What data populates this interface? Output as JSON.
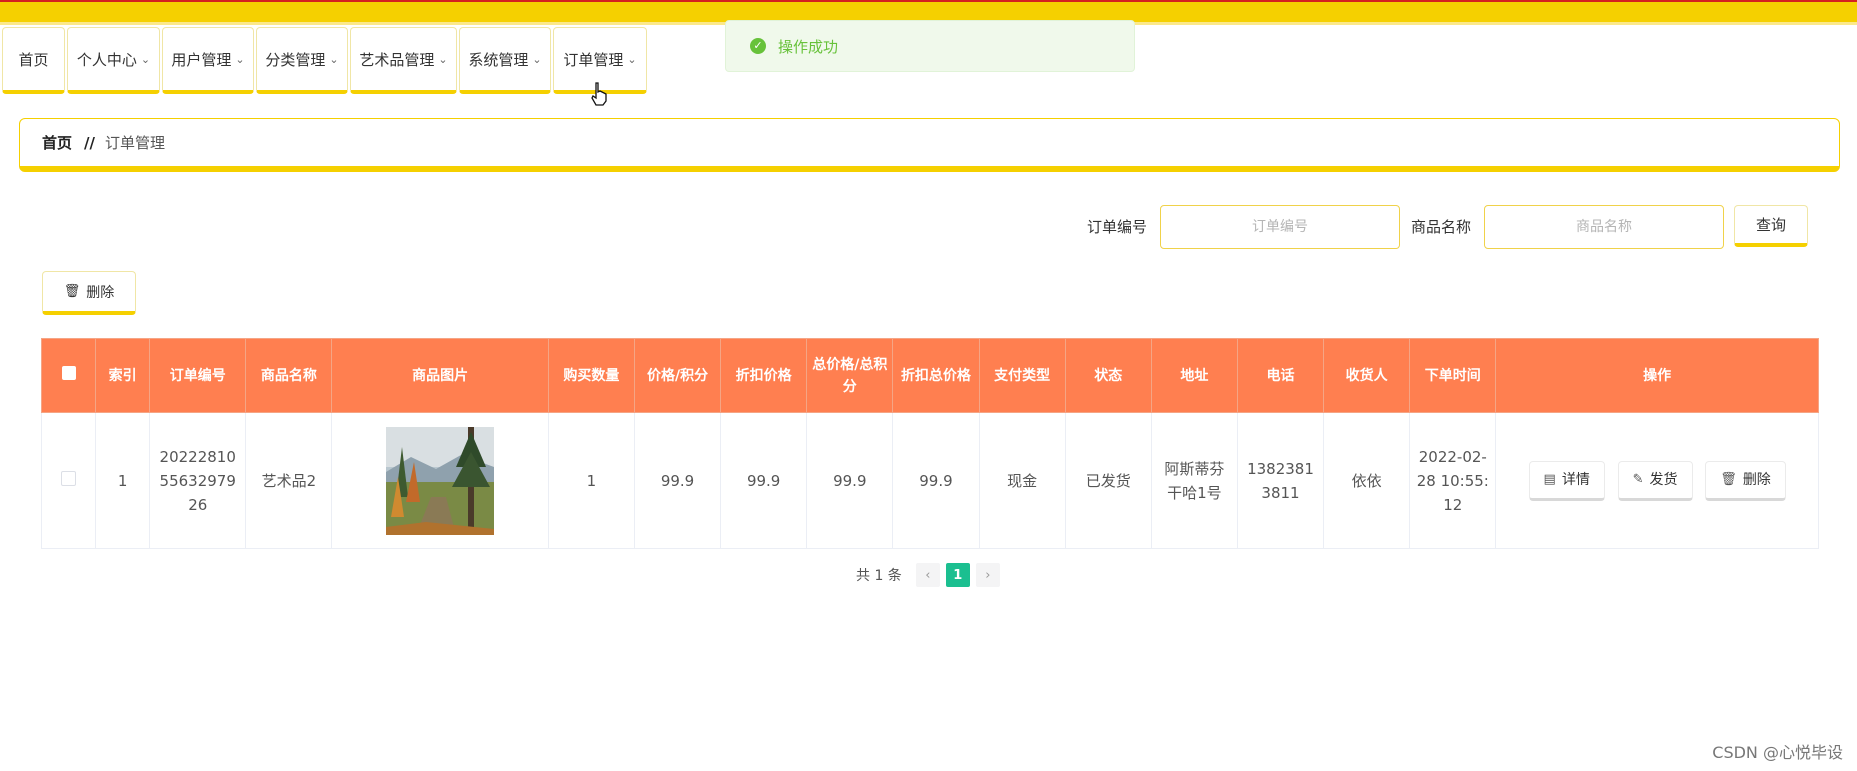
{
  "nav": {
    "items": [
      {
        "label": "首页",
        "has_dropdown": false
      },
      {
        "label": "个人中心",
        "has_dropdown": true
      },
      {
        "label": "用户管理",
        "has_dropdown": true
      },
      {
        "label": "分类管理",
        "has_dropdown": true
      },
      {
        "label": "艺术品管理",
        "has_dropdown": true
      },
      {
        "label": "系统管理",
        "has_dropdown": true
      },
      {
        "label": "订单管理",
        "has_dropdown": true
      }
    ]
  },
  "toast": {
    "message": "操作成功",
    "icon": "check-circle-icon",
    "color": "#67c23a"
  },
  "breadcrumb": {
    "home": "首页",
    "separator": "//",
    "current": "订单管理"
  },
  "search": {
    "order_no_label": "订单编号",
    "order_no_placeholder": "订单编号",
    "goods_name_label": "商品名称",
    "goods_name_placeholder": "商品名称",
    "query_label": "查询"
  },
  "toolbar": {
    "delete_label": "删除",
    "delete_icon": "trash-icon"
  },
  "table": {
    "header_color": "#ff7f50",
    "columns": [
      "索引",
      "订单编号",
      "商品名称",
      "商品图片",
      "购买数量",
      "价格/积分",
      "折扣价格",
      "总价格/总积分",
      "折扣总价格",
      "支付类型",
      "状态",
      "地址",
      "电话",
      "收货人",
      "下单时间",
      "操作"
    ],
    "rows": [
      {
        "index": "1",
        "order_no": "202228105563297926",
        "goods_name": "艺术品2",
        "image": "landscape-painting",
        "quantity": "1",
        "price": "99.9",
        "discount_price": "99.9",
        "total_price": "99.9",
        "discount_total": "99.9",
        "pay_type": "现金",
        "status": "已发货",
        "address": "阿斯蒂芬干哈1号",
        "phone": "13823813811",
        "receiver": "依依",
        "order_time": "2022-02-28 10:55:12",
        "actions": {
          "detail": "详情",
          "ship": "发货",
          "delete": "删除"
        }
      }
    ]
  },
  "pagination": {
    "total_text": "共 1 条",
    "current_page": "1",
    "prev": "‹",
    "next": "›"
  },
  "watermark": "CSDN @心悦毕设",
  "accent": "#f5d000",
  "pager_active_color": "#1bbf90"
}
